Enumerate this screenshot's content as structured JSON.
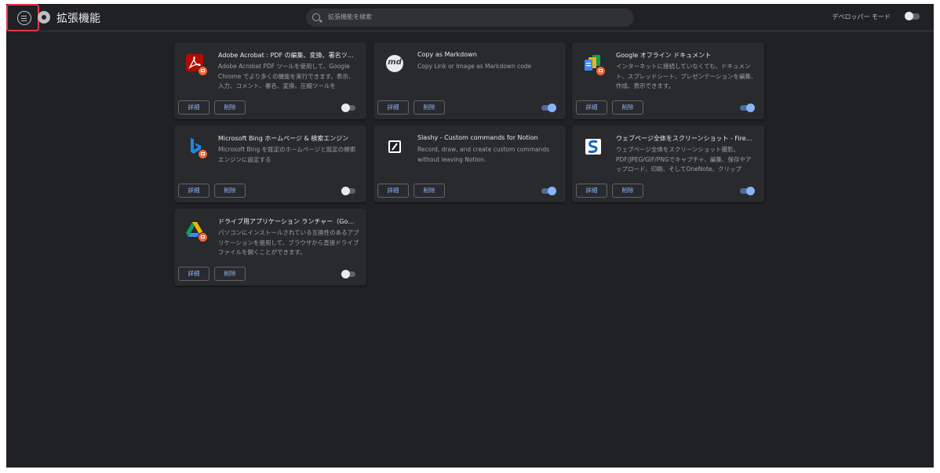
{
  "header": {
    "title": "拡張機能",
    "search_placeholder": "拡張機能を検索",
    "developer_mode_label": "デベロッパー モード",
    "developer_mode_on": false
  },
  "buttons": {
    "details": "詳細",
    "remove": "削除"
  },
  "extensions": [
    {
      "name": "Adobe Acrobat : PDF の編集、変換、署名ツール",
      "description": "Adobe Acrobat PDF ツールを使用して、Google Chrome でより多くの機能を実行できます。表示、入力、コメント、署名、変換、圧縮ツールを",
      "enabled": false,
      "icon": "adobe-acrobat-icon",
      "managed_badge": true
    },
    {
      "name": "Copy as Markdown",
      "description": "Copy Link or Image as Markdown code",
      "enabled": true,
      "icon": "markdown-icon",
      "icon_text": "md",
      "managed_badge": false
    },
    {
      "name": "Google オフライン ドキュメント",
      "description": "インターネットに接続していなくても、ドキュメント、スプレッドシート、プレゼンテーションを編集、作成、表示できます。",
      "enabled": true,
      "icon": "google-docs-offline-icon",
      "managed_badge": true
    },
    {
      "name": "Microsoft Bing ホームページ & 検索エンジン",
      "description": "Microsoft Bing を既定のホームページと既定の検索エンジンに設定する",
      "enabled": false,
      "icon": "bing-icon",
      "managed_badge": true
    },
    {
      "name": "Slashy - Custom commands for Notion",
      "description": "Record, draw, and create custom commands without leaving Notion.",
      "enabled": true,
      "icon": "slashy-icon",
      "managed_badge": false
    },
    {
      "name": "ウェブページ全体をスクリーンショット - Fire…",
      "description": "ウェブページ全体をスクリーンショット撮影。PDF/JPEG/GIF/PNGでキャプチャ、編集、保存やアップロード、印刷、そしてOneNote、クリップ",
      "enabled": true,
      "icon": "fireshot-icon",
      "managed_badge": false
    },
    {
      "name": "ドライブ用アプリケーション ランチャー（Go…",
      "description": "パソコンにインストールされている互換性のあるアプリケーションを使用して、ブラウザから直接ドライブ ファイルを開くことができます。",
      "enabled": false,
      "icon": "google-drive-icon",
      "managed_badge": true
    }
  ],
  "colors": {
    "background": "#202124",
    "card": "#292a2d",
    "accent": "#8ab4f8",
    "highlight": "#e8334a"
  }
}
